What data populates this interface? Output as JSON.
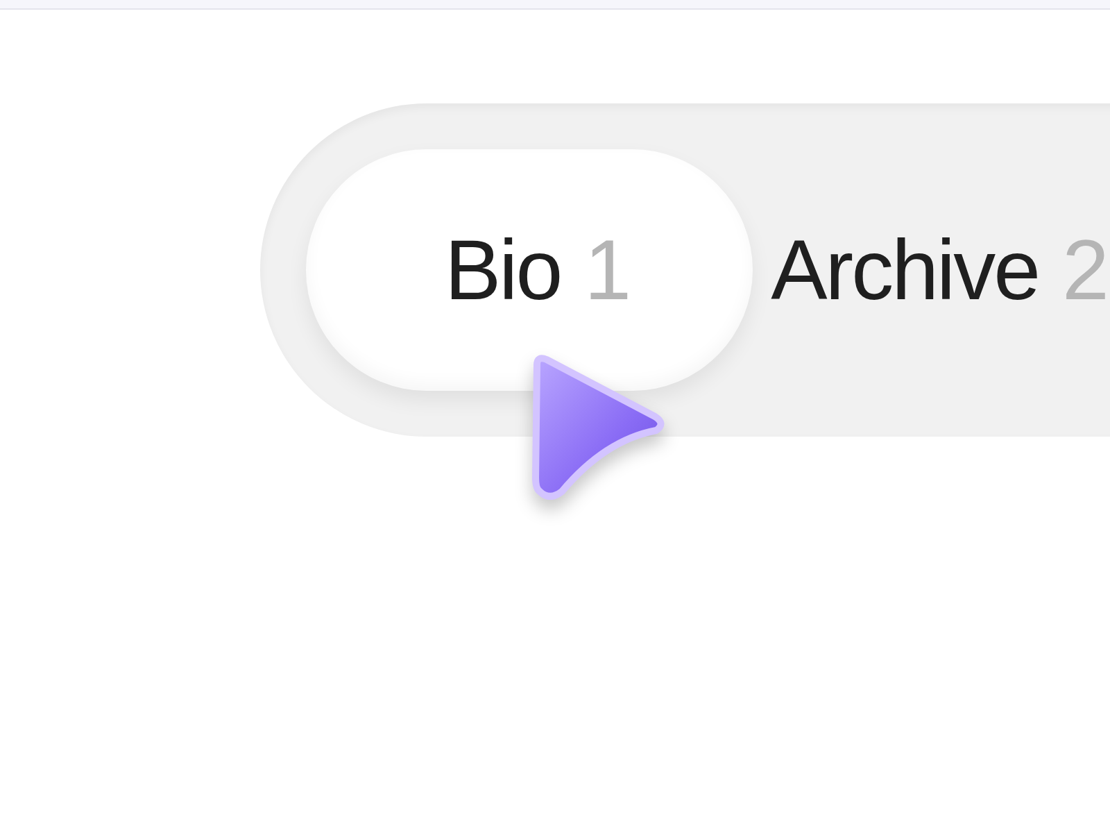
{
  "tabs": [
    {
      "label": "Bio",
      "count": "1",
      "selected": true
    },
    {
      "label": "Archive",
      "count": "2",
      "selected": false
    }
  ]
}
